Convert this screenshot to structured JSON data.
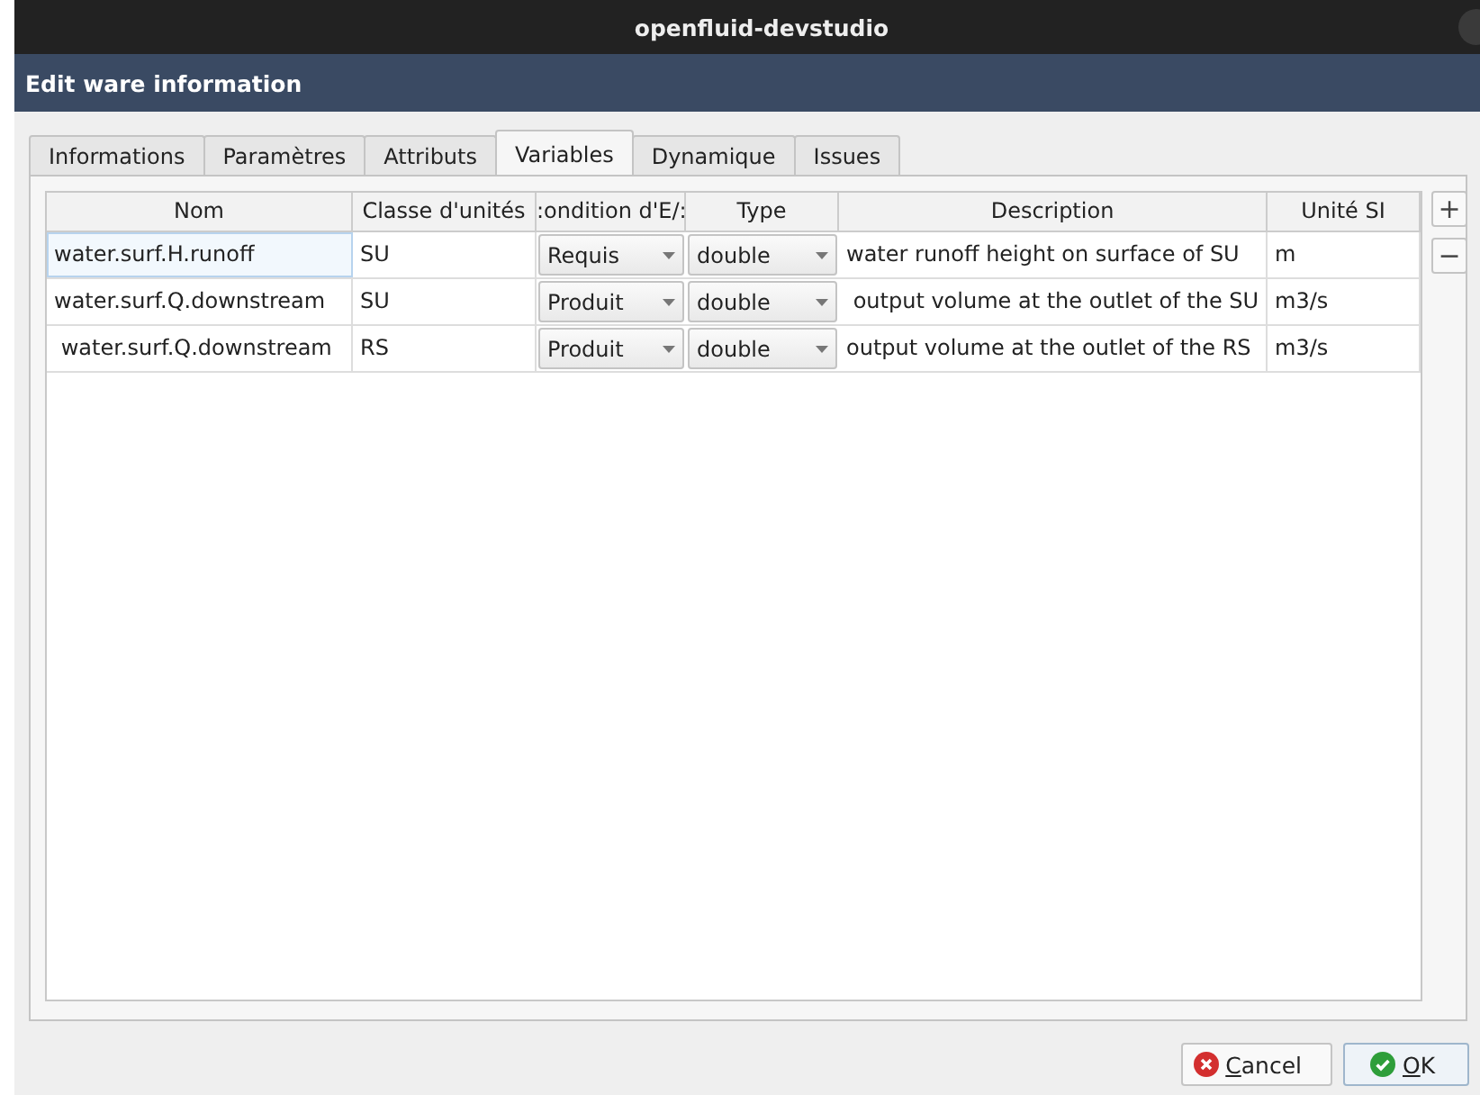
{
  "window": {
    "title": "openfluid-devstudio"
  },
  "header": {
    "title": "Edit ware information"
  },
  "tabs": [
    {
      "label": "Informations",
      "selected": false
    },
    {
      "label": "Paramètres",
      "selected": false
    },
    {
      "label": "Attributs",
      "selected": false
    },
    {
      "label": "Variables",
      "selected": true
    },
    {
      "label": "Dynamique",
      "selected": false
    },
    {
      "label": "Issues",
      "selected": false
    }
  ],
  "table": {
    "columns": [
      "Nom",
      "Classe d'unités",
      ":ondition d'E/:",
      "Type",
      "Description",
      "Unité SI"
    ],
    "rows": [
      {
        "selected": true,
        "cells": [
          {
            "kind": "text",
            "text": "water.surf.H.runoff"
          },
          {
            "kind": "text",
            "text": "SU"
          },
          {
            "kind": "combo",
            "text": "Requis"
          },
          {
            "kind": "combo",
            "text": "double"
          },
          {
            "kind": "text",
            "text": "water runoff height on surface of SU"
          },
          {
            "kind": "text",
            "text": "m"
          }
        ]
      },
      {
        "selected": false,
        "cells": [
          {
            "kind": "text",
            "text": "water.surf.Q.downstream"
          },
          {
            "kind": "text",
            "text": "SU"
          },
          {
            "kind": "combo",
            "text": "Produit"
          },
          {
            "kind": "combo",
            "text": "double"
          },
          {
            "kind": "text",
            "text": " output volume at the outlet of the SU"
          },
          {
            "kind": "text",
            "text": "m3/s"
          }
        ]
      },
      {
        "selected": false,
        "cells": [
          {
            "kind": "text",
            "text": " water.surf.Q.downstream"
          },
          {
            "kind": "text",
            "text": "RS"
          },
          {
            "kind": "combo",
            "text": "Produit"
          },
          {
            "kind": "combo",
            "text": "double"
          },
          {
            "kind": "text",
            "text": "output volume at the outlet of the RS"
          },
          {
            "kind": "text",
            "text": "m3/s"
          }
        ]
      }
    ]
  },
  "side_buttons": [
    "+",
    "−"
  ],
  "buttons": [
    {
      "kind": "cancel",
      "label": "Cancel"
    },
    {
      "kind": "ok",
      "label": "OK"
    }
  ]
}
